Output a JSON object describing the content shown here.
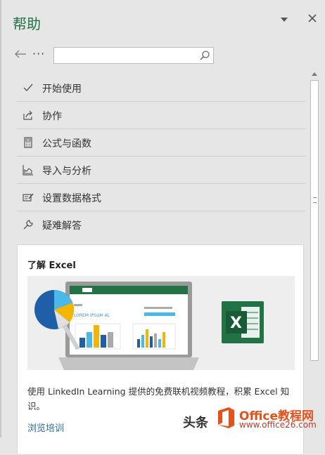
{
  "header": {
    "title": "帮助",
    "dropdown_icon": "chevron-down-icon",
    "close_icon": "close-icon"
  },
  "nav": {
    "back_icon": "arrow-left-icon",
    "more_label": "···",
    "search_placeholder": ""
  },
  "menu": [
    {
      "label": "开始使用",
      "icon": "checkmark-icon"
    },
    {
      "label": "协作",
      "icon": "share-icon"
    },
    {
      "label": "公式与函数",
      "icon": "calculator-icon"
    },
    {
      "label": "导入与分析",
      "icon": "chart-icon"
    },
    {
      "label": "设置数据格式",
      "icon": "format-icon"
    },
    {
      "label": "疑难解答",
      "icon": "wrench-icon"
    }
  ],
  "card": {
    "title": "了解 Excel",
    "banner_heading": "LOREM IPSUM AL",
    "description": "使用 LinkedIn Learning 提供的免费联机视频教程，积累 Excel 知识。",
    "link": "浏览培训"
  },
  "watermark": {
    "text": "头条",
    "brand": "Office教程网",
    "url": "www.office26.com"
  },
  "colors": {
    "accent": "#217346",
    "link": "#2b6cb0",
    "brand_orange": "#e8501a"
  }
}
